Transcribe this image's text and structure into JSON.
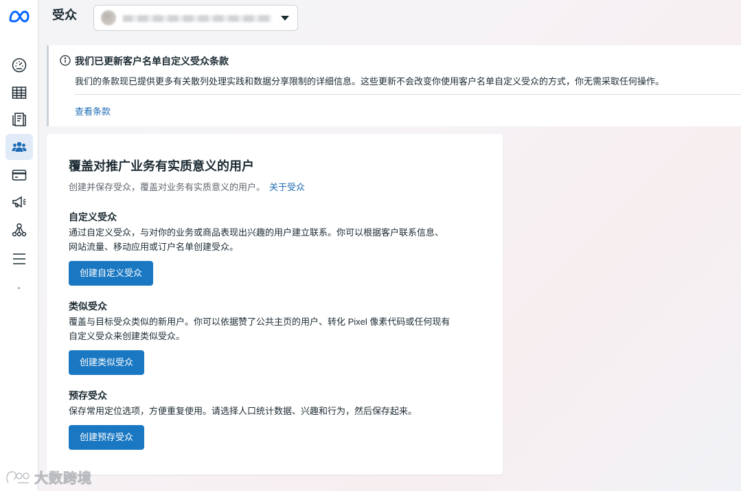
{
  "header": {
    "title": "受众",
    "account_selector": {
      "value": ""
    }
  },
  "nav": {
    "items": [
      {
        "icon": "dashboard-gauge-icon"
      },
      {
        "icon": "table-grid-icon"
      },
      {
        "icon": "pages-document-icon"
      },
      {
        "icon": "audience-people-icon",
        "active": true
      },
      {
        "icon": "credit-card-icon"
      },
      {
        "icon": "megaphone-icon"
      },
      {
        "icon": "network-nodes-icon"
      },
      {
        "icon": "hamburger-menu-icon"
      }
    ]
  },
  "notice": {
    "title": "我们已更新客户名单自定义受众条款",
    "body": "我们的条款现已提供更多有关散列处理实践和数据分享限制的详细信息。这些更新不会改变你使用客户名单自定义受众的方式，你无需采取任何操作。",
    "link": "查看条款"
  },
  "card": {
    "title": "覆盖对推广业务有实质意义的用户",
    "subtitle": "创建并保存受众，覆盖对业务有实质意义的用户。",
    "subtitle_link": "关于受众",
    "sections": [
      {
        "title": "自定义受众",
        "desc_line1": "通过自定义受众，与对你的业务或商品表现出兴趣的用户建立联系。你可以根据客户联系信息、",
        "desc_line2": "网站流量、移动应用或订户名单创建受众。",
        "button": "创建自定义受众"
      },
      {
        "title": "类似受众",
        "desc_line1": "覆盖与目标受众类似的新用户。你可以依据赞了公共主页的用户、转化 Pixel 像素代码或任何现有",
        "desc_line2": "自定义受众来创建类似受众。",
        "button": "创建类似受众"
      },
      {
        "title": "预存受众",
        "desc_line1": "保存常用定位选项，方便重复使用。请选择人口统计数据、兴趣和行为，然后保存起来。",
        "button": "创建预存受众"
      }
    ]
  },
  "watermark": {
    "text": "大数跨境"
  },
  "colors": {
    "primary_button": "#1a78c2",
    "link": "#1d6bb3",
    "nav_active_bg": "#e0ebf7",
    "meta_blue": "#0866ff"
  }
}
